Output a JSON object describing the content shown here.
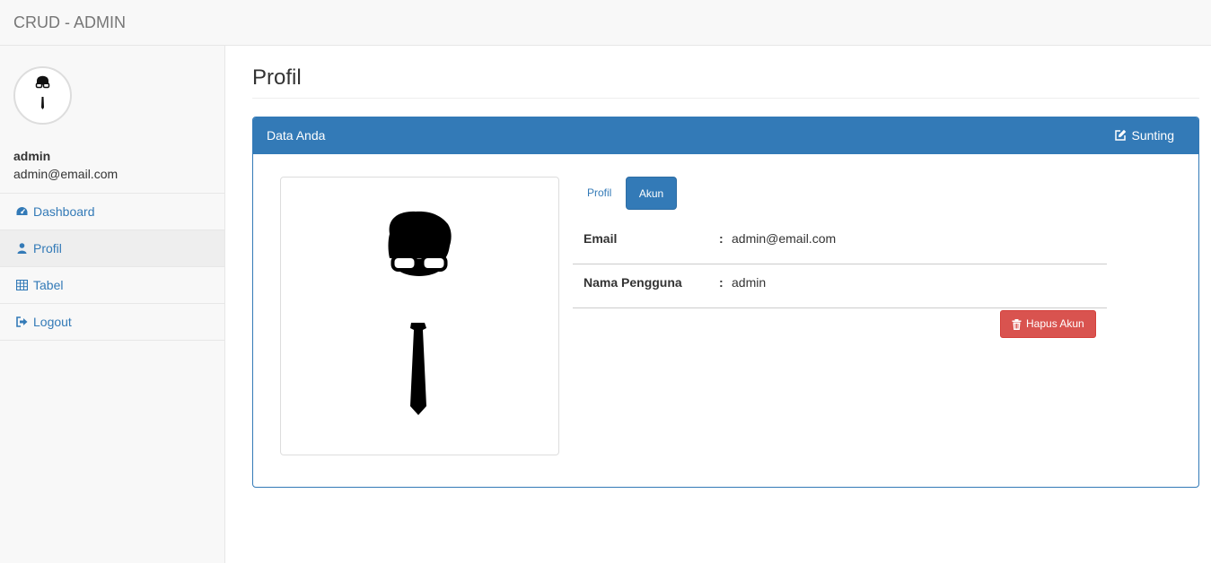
{
  "navbar": {
    "brand": "CRUD - ADMIN"
  },
  "sidebar": {
    "user": {
      "name": "admin",
      "email": "admin@email.com"
    },
    "menu": [
      {
        "label": "Dashboard",
        "icon": "dashboard-icon",
        "active": false
      },
      {
        "label": "Profil",
        "icon": "user-icon",
        "active": true
      },
      {
        "label": "Tabel",
        "icon": "table-icon",
        "active": false
      },
      {
        "label": "Logout",
        "icon": "logout-icon",
        "active": false
      }
    ]
  },
  "main": {
    "title": "Profil",
    "panel": {
      "title": "Data Anda",
      "edit_label": "Sunting",
      "tabs": [
        {
          "label": "Profil",
          "active": false
        },
        {
          "label": "Akun",
          "active": true
        }
      ],
      "fields": [
        {
          "label": "Email",
          "separator": ":",
          "value": "admin@email.com"
        },
        {
          "label": "Nama Pengguna",
          "separator": ":",
          "value": "admin"
        }
      ],
      "delete_label": "Hapus Akun"
    }
  },
  "colors": {
    "primary": "#337ab7",
    "danger": "#d9534f",
    "navbar_bg": "#f8f8f8",
    "active_menu_bg": "#eeeeee"
  }
}
